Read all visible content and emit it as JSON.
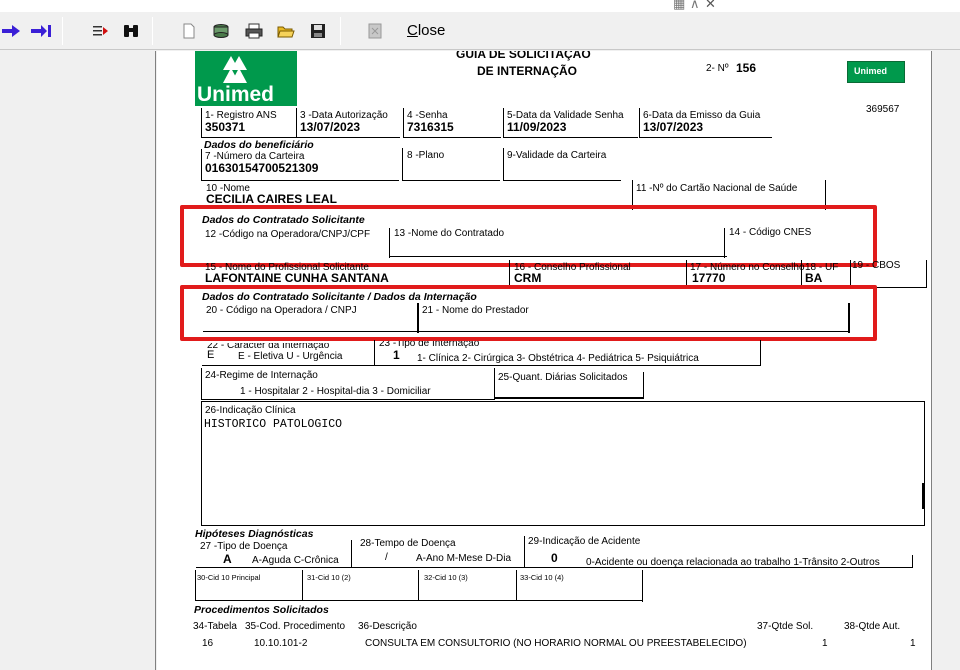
{
  "toolbar": {
    "close_label": "Close",
    "close_underline": "C",
    "close_rest": "lose"
  },
  "colors": {
    "green": "#00994c",
    "highlight": "#e11b1b",
    "arrow": "#3a1fd6"
  },
  "form": {
    "title_line1": "GUIA DE SOLICITAÇÃO",
    "title_line2": "DE INTERNAÇÃO",
    "number_label": "2- Nº",
    "number_value": "156",
    "logo_text": "Unimed",
    "badge_text": "Unimed",
    "code_right": "369567",
    "f1_label": "1- Registro ANS",
    "f1_value": "350371",
    "f3_label": "3 -Data Autorização",
    "f3_value": "13/07/2023",
    "f4_label": "4 -Senha",
    "f4_value": "7316315",
    "f5_label": "5-Data da Validade Senha",
    "f5_value": "11/09/2023",
    "f6_label": "6-Data da Emisso da Guia",
    "f6_value": "13/07/2023",
    "sec_beneficiario": "Dados do beneficiário",
    "f7_label": "7 -Número da Carteira",
    "f7_value": "01630154700521309",
    "f8_label": "8 -Plano",
    "f9_label": "9-Validade da Carteira",
    "f10_label": "10 -Nome",
    "f10_value": "CECILIA CAIRES LEAL",
    "f11_label": "11 -Nº do Cartão Nacional de Saúde",
    "sec_contratado": "Dados do Contratado Solicitante",
    "f12_label": "12 -Código na Operadora/CNPJ/CPF",
    "f13_label": "13 -Nome do Contratado",
    "f14_label": "14 - Código CNES",
    "f15_label": "15 - Nome do Profissional Solicitante",
    "f15_value": "LAFONTAINE CUNHA SANTANA",
    "f16_label": "16 - Conselho Profissional",
    "f16_value": "CRM",
    "f17_label": "17 - Número no Conselho",
    "f17_value": "17770",
    "f18_label": "18 - UF",
    "f18_value": "BA",
    "f19_label": "19 - CBOS",
    "sec_internacao": "Dados do Contratado Solicitante / Dados da Internação",
    "f20_label": "20 - Código na Operadora / CNPJ",
    "f21_label": "21 - Nome do Prestador",
    "f22_label": "22 - Caracter da Internação",
    "f22_value": "E",
    "f22_options": "E - Eletiva    U - Urgência",
    "f23_label": "23 -Tipo de Internação",
    "f23_value": "1",
    "f23_options": "1- Clínica  2- Cirúrgica  3- Obstétrica   4- Pediátrica   5- Psiquiátrica",
    "f24_label": "24-Regime de Internação",
    "f24_options": "1 - Hospitalar  2 - Hospital-dia  3 - Domiciliar",
    "f25_label": "25-Quant. Diárias Solicitados",
    "f26_label": "26-Indicação Clínica",
    "f26_value": "HISTORICO PATOLOGICO",
    "sec_hipoteses": "Hipóteses Diagnósticas",
    "f27_label": "27 -Tipo de Doença",
    "f27_value": "A",
    "f27_options": "A-Aguda C-Crônica",
    "f28_label": "28-Tempo de Doença",
    "f28_value": "/",
    "f28_options": "A-Ano M-Mese D-Dia",
    "f29_label": "29-Indicação de Acidente",
    "f29_value": "0",
    "f29_options": "0-Acidente ou doença relacionada ao trabalho 1-Trânsito 2-Outros",
    "f30_label": "30-Cid 10 Principal",
    "f31_label": "31-Cid 10 (2)",
    "f32_label": "32-Cid 10 (3)",
    "f33_label": "33-Cid 10 (4)",
    "sec_procedimentos": "Procedimentos Solicitados",
    "h34": "34-Tabela",
    "h35": "35-Cod. Procedimento",
    "h36": "36-Descrição",
    "h37": "37-Qtde Sol.",
    "h38": "38-Qtde Aut.",
    "row_tabela": "16",
    "row_codigo": "10.10.101-2",
    "row_descricao": "CONSULTA EM CONSULTORIO (NO HORARIO NORMAL OU PREESTABELECIDO)",
    "row_qtde_sol": "1",
    "row_qtde_aut": "1"
  }
}
